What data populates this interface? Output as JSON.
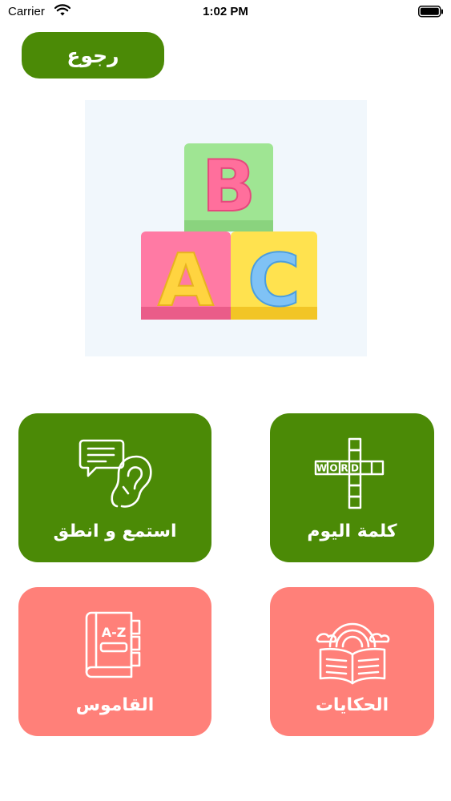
{
  "status_bar": {
    "carrier": "Carrier",
    "time": "1:02 PM"
  },
  "header": {
    "back_label": "رجوع"
  },
  "hero": {
    "image": "abc-alphabet-blocks",
    "letters": [
      "B",
      "A",
      "C"
    ]
  },
  "menu": {
    "listen_speak": {
      "label": "استمع و انطق",
      "icon": "speech-bubble-ear-icon"
    },
    "word_of_day": {
      "label": "كلمة اليوم",
      "icon": "crossword-icon",
      "word_letters": [
        "W",
        "O",
        "R",
        "D"
      ]
    },
    "dictionary": {
      "label": "القاموس",
      "icon": "book-a-z-icon",
      "book_text": "A-Z"
    },
    "stories": {
      "label": "الحكايات",
      "icon": "open-book-rainbow-icon"
    }
  },
  "colors": {
    "green": "#4b8a06",
    "pink": "#ff8079",
    "hero_bg": "#f1f7fc"
  }
}
